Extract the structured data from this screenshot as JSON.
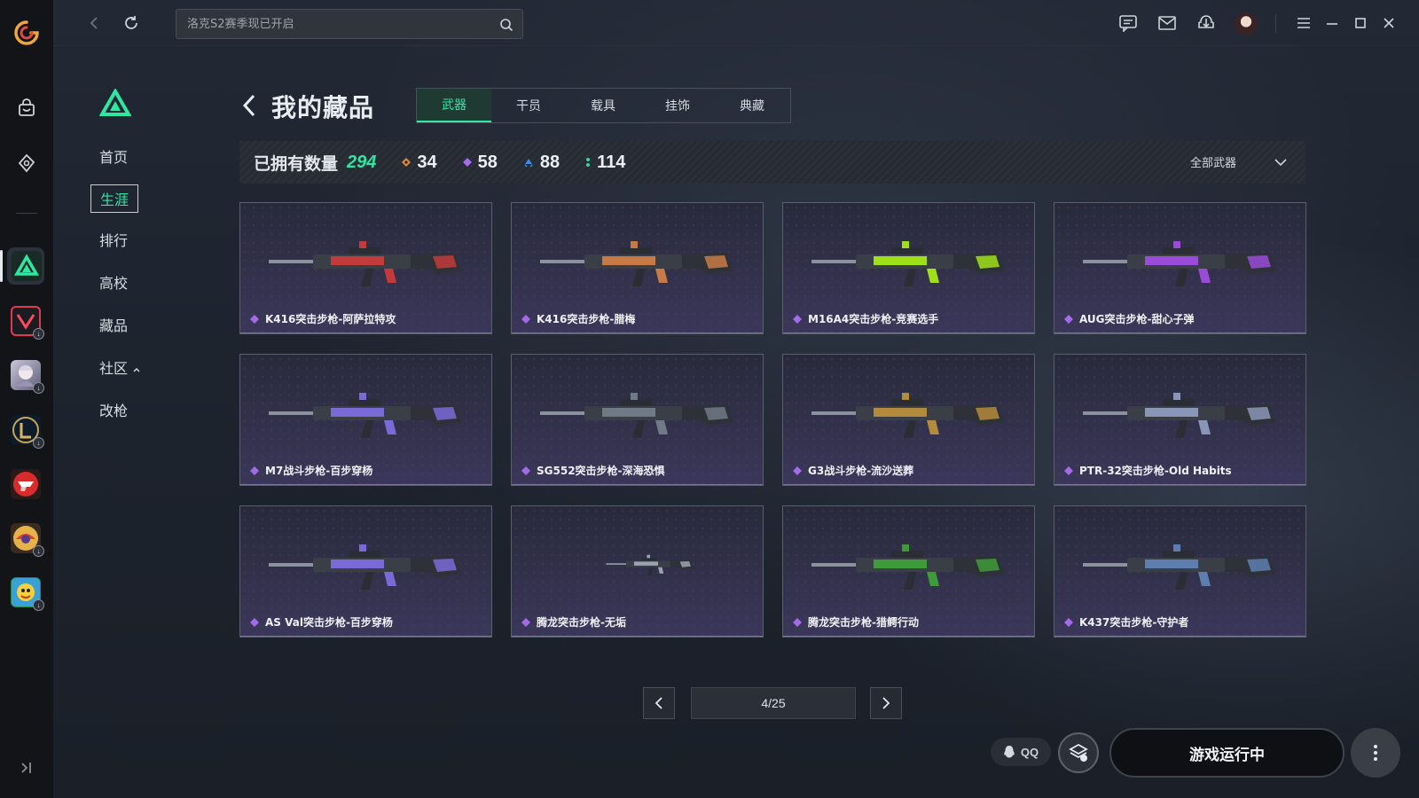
{
  "topbar": {
    "search_placeholder": "洛克S2赛季现已开启"
  },
  "subnav": {
    "items": [
      {
        "label": "首页"
      },
      {
        "label": "生涯"
      },
      {
        "label": "排行"
      },
      {
        "label": "高校"
      },
      {
        "label": "藏品"
      },
      {
        "label": "社区"
      },
      {
        "label": "改枪"
      }
    ],
    "active_index": 1
  },
  "header": {
    "title": "我的藏品",
    "tabs": [
      "武器",
      "干员",
      "载具",
      "挂饰",
      "典藏"
    ],
    "active_tab": 0
  },
  "stats": {
    "owned_label": "已拥有数量",
    "owned_total": "294",
    "counts": [
      {
        "value": "34",
        "color": "#e0873b"
      },
      {
        "value": "58",
        "color": "#a46be8"
      },
      {
        "value": "88",
        "color": "#3d8fe6"
      },
      {
        "value": "114",
        "color": "#35d4a0"
      }
    ],
    "filter_label": "全部武器"
  },
  "items": [
    {
      "name": "K416突击步枪-阿萨拉特攻",
      "accent": "#c23a3a"
    },
    {
      "name": "K416突击步枪-腊梅",
      "accent": "#c87a46"
    },
    {
      "name": "M16A4突击步枪-竞赛选手",
      "accent": "#9fe018"
    },
    {
      "name": "AUG突击步枪-甜心子弹",
      "accent": "#9a4cd8"
    },
    {
      "name": "M7战斗步枪-百步穿杨",
      "accent": "#7a6ad8"
    },
    {
      "name": "SG552突击步枪-深海恐惧",
      "accent": "#6f7a86"
    },
    {
      "name": "G3战斗步枪-流沙送葬",
      "accent": "#b48a3c"
    },
    {
      "name": "PTR-32突击步枪-Old Habits",
      "accent": "#8a96b8"
    },
    {
      "name": "AS Val突击步枪-百步穿杨",
      "accent": "#7a6ad8"
    },
    {
      "name": "腾龙突击步枪-无垢",
      "accent": "#9aa4b0"
    },
    {
      "name": "腾龙突击步枪-猎鳄行动",
      "accent": "#3f9a3a"
    },
    {
      "name": "K437突击步枪-守护者",
      "accent": "#5c7fb0"
    }
  ],
  "pagination": {
    "page_label": "4/25"
  },
  "footer": {
    "qq_label": "QQ",
    "run_label": "游戏运行中"
  }
}
